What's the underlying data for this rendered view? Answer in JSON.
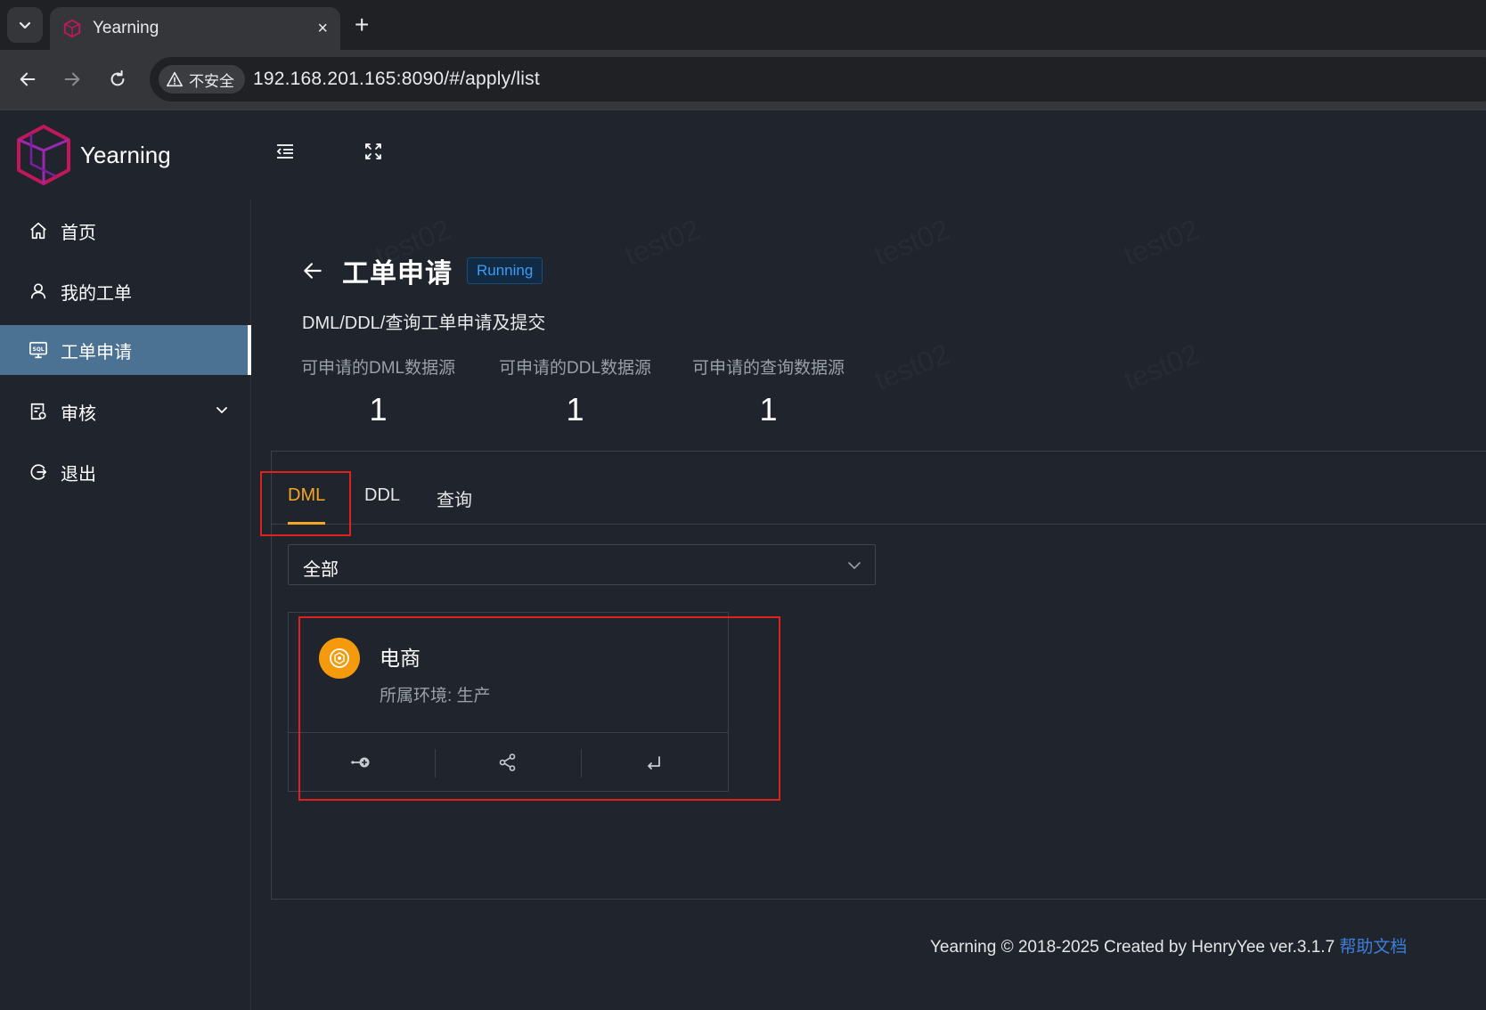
{
  "browser": {
    "tab_title": "Yearning",
    "tab_close": "×",
    "new_tab": "+",
    "security_label": "不安全",
    "url": "192.168.201.165:8090/#/apply/list"
  },
  "app": {
    "logo_text": "Yearning",
    "watermark": "test02"
  },
  "sidebar": {
    "items": [
      {
        "label": "首页",
        "icon": "home-icon"
      },
      {
        "label": "我的工单",
        "icon": "user-icon"
      },
      {
        "label": "工单申请",
        "icon": "sql-monitor-icon",
        "active": true
      },
      {
        "label": "审核",
        "icon": "audit-icon",
        "has_submenu": true
      },
      {
        "label": "退出",
        "icon": "logout-icon"
      }
    ]
  },
  "header": {
    "title": "工单申请",
    "status": "Running",
    "subtitle": "DML/DDL/查询工单申请及提交"
  },
  "stats": [
    {
      "label": "可申请的DML数据源",
      "value": "1"
    },
    {
      "label": "可申请的DDL数据源",
      "value": "1"
    },
    {
      "label": "可申请的查询数据源",
      "value": "1"
    }
  ],
  "tabs": [
    {
      "label": "DML",
      "active": true
    },
    {
      "label": "DDL"
    },
    {
      "label": "查询"
    }
  ],
  "filter": {
    "selected": "全部"
  },
  "cards": [
    {
      "title": "电商",
      "description": "所属环境: 生产",
      "actions": [
        "apply-icon",
        "share-icon",
        "enter-icon"
      ]
    }
  ],
  "footer": {
    "text": "Yearning © 2018-2025 Created by HenryYee ver.3.1.7",
    "link": "帮助文档"
  },
  "colors": {
    "accent": "#f5a623",
    "active_menu_bg": "#4b7193",
    "status_tag": "#3d9bf4",
    "annotation_red": "#e0211e"
  }
}
